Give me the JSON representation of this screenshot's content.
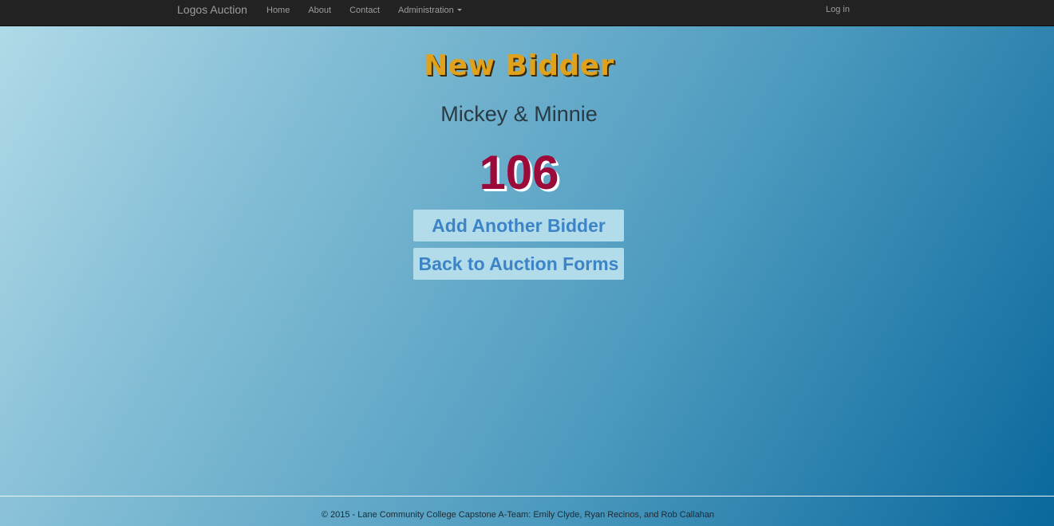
{
  "navbar": {
    "brand": "Logos Auction",
    "links": [
      {
        "label": "Home"
      },
      {
        "label": "About"
      },
      {
        "label": "Contact"
      },
      {
        "label": "Administration"
      }
    ],
    "login": "Log in"
  },
  "main": {
    "title": "New Bidder",
    "bidder_name": "Mickey & Minnie",
    "bidder_number": "106",
    "buttons": {
      "add_another": "Add Another Bidder",
      "back_to_forms": "Back to Auction Forms"
    }
  },
  "footer": {
    "text": "© 2015 - Lane Community College Capstone A-Team: Emily Clyde, Ryan Recinos, and Rob Callahan"
  },
  "colors": {
    "navbar_bg": "#222222",
    "title": "#e0a21c",
    "bidder_number": "#9c0a3a",
    "button_bg": "#b3dcea",
    "button_text": "#3d84c6"
  }
}
